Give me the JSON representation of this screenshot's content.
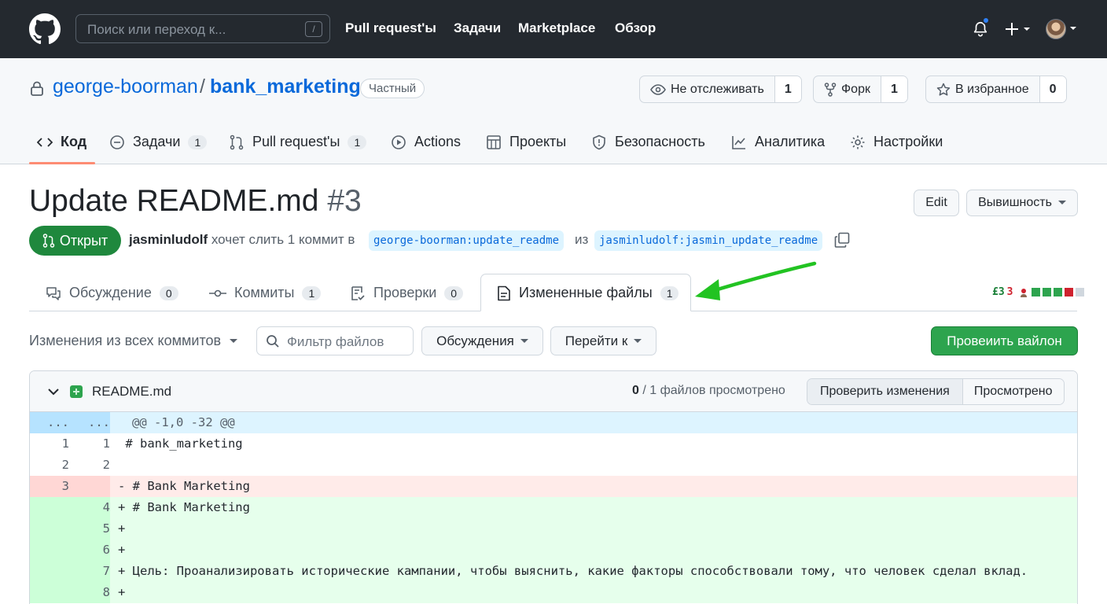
{
  "header": {
    "search_placeholder": "Поиск или переход к...",
    "search_key": "/",
    "nav": [
      "Pull request'ы",
      "Задачи",
      "Marketplace",
      "Обзор"
    ]
  },
  "repo": {
    "owner": "george-boorman",
    "separator": "/",
    "name": "bank_marketing",
    "visibility": "Частный",
    "watch_label": "Не отслеживать",
    "watch_count": "1",
    "fork_label": "Форк",
    "fork_count": "1",
    "star_label": "В избранное",
    "star_count": "0"
  },
  "repo_tabs": [
    {
      "label": "Код",
      "icon": "code-icon"
    },
    {
      "label": "Задачи",
      "count": "1",
      "icon": "issue-icon"
    },
    {
      "label": "Pull request'ы",
      "count": "1",
      "icon": "pull-request-icon"
    },
    {
      "label": "Actions",
      "icon": "play-icon"
    },
    {
      "label": "Проекты",
      "icon": "table-icon"
    },
    {
      "label": "Безопасность",
      "icon": "shield-icon"
    },
    {
      "label": "Аналитика",
      "icon": "graph-icon"
    },
    {
      "label": "Настройки",
      "icon": "gear-icon"
    }
  ],
  "pr": {
    "title": "Update README.md",
    "number": "#3",
    "edit_label": "Edit",
    "code_label": "Вывишность",
    "state": "Открыт",
    "author": "jasminludolf",
    "action_text": "хочет слить 1 коммит в",
    "base_branch": "george-boorman:update_readme",
    "from_text": "из",
    "head_branch": "jasminludolf:jasmin_update_readme"
  },
  "pr_tabs": [
    {
      "label": "Обсуждение",
      "count": "0",
      "icon": "comment-icon"
    },
    {
      "label": "Коммиты",
      "count": "1",
      "icon": "commit-icon"
    },
    {
      "label": "Проверки",
      "count": "0",
      "icon": "checklist-icon"
    },
    {
      "label": "Измененные файлы",
      "count": "1",
      "icon": "file-diff-icon"
    }
  ],
  "diffstat": {
    "additions": "£3",
    "deletions": "3"
  },
  "toolbar": {
    "changes_from": "Изменения из всех коммитов",
    "filter_placeholder": "Фильтр файлов",
    "discussions": "Обсуждения",
    "jump_to": "Перейти к",
    "review_button": "Провеиить вайлон"
  },
  "file": {
    "name": "README.md",
    "viewed_count": "0",
    "viewed_suffix": "/ 1 файлов просмотрено",
    "review_changes": "Проверить изменения",
    "viewed_button": "Просмотрено",
    "lines": [
      {
        "type": "hunk",
        "left": "...",
        "right": "...",
        "text": "@@ -1,0 -32 @@"
      },
      {
        "type": "ctx",
        "left": "1",
        "right": "1",
        "text": " # bank_marketing"
      },
      {
        "type": "ctx",
        "left": "2",
        "right": "2",
        "text": ""
      },
      {
        "type": "del",
        "left": "3",
        "right": "",
        "text": "- # Bank Marketing"
      },
      {
        "type": "add",
        "left": "",
        "right": "4",
        "text": "+ # Bank Marketing"
      },
      {
        "type": "add",
        "left": "",
        "right": "5",
        "text": "+"
      },
      {
        "type": "add",
        "left": "",
        "right": "6",
        "text": "+"
      },
      {
        "type": "add",
        "left": "",
        "right": "7",
        "text": "+ Цель: Проанализировать исторические кампании, чтобы выяснить, какие факторы способствовали тому, что человек сделал вклад."
      },
      {
        "type": "add",
        "left": "",
        "right": "8",
        "text": "+"
      }
    ]
  },
  "colors": {
    "header_bg": "#24292f",
    "accent_blue": "#0969da",
    "open_green": "#1f883d",
    "tab_underline": "#fd8c73",
    "arrow_green": "#22c322"
  }
}
